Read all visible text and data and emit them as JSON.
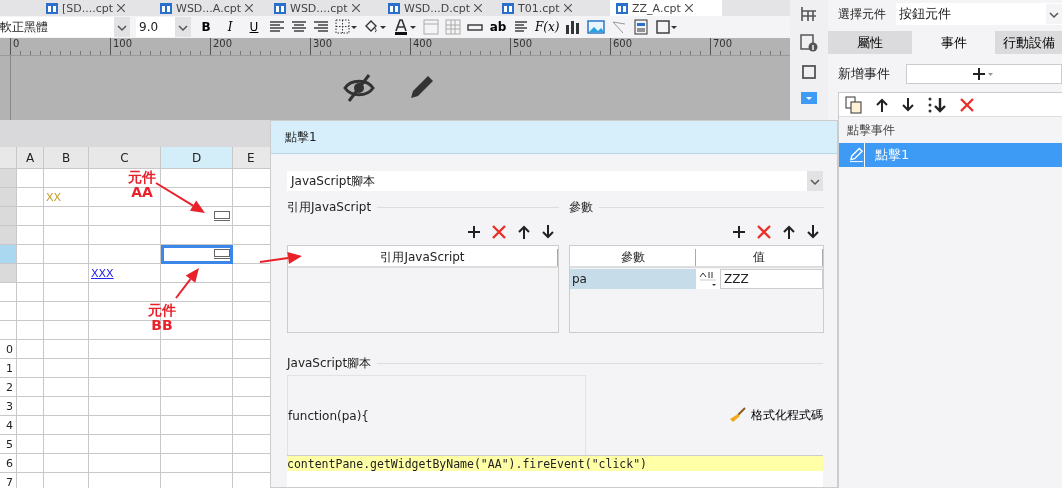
{
  "file_tabs": [
    {
      "label": "[SD....cpt",
      "selected": false
    },
    {
      "label": "WSD...A.cpt",
      "selected": false
    },
    {
      "label": "WSD....cpt",
      "selected": false
    },
    {
      "label": "WSD...D.cpt",
      "selected": false
    },
    {
      "label": "T01.cpt",
      "selected": false
    },
    {
      "label": "ZZ_A.cpt",
      "selected": true
    }
  ],
  "toolbar": {
    "font": "軟正黑體",
    "font_size": "9.0",
    "style_buttons": [
      "B",
      "I",
      "U"
    ],
    "text_widget": "ab",
    "formula": "F(x)"
  },
  "ruler": {
    "ticks": [
      "0",
      "100",
      "200",
      "300",
      "400",
      "500",
      "600",
      "700"
    ]
  },
  "sheet": {
    "columns": [
      {
        "label": "A",
        "selected": false
      },
      {
        "label": "B",
        "selected": false
      },
      {
        "label": "C",
        "selected": false
      },
      {
        "label": "D",
        "selected": true
      },
      {
        "label": "E",
        "selected": false
      }
    ],
    "rows": [
      {
        "selected": false,
        "shaded": true,
        "cells": []
      },
      {
        "selected": false,
        "shaded": true,
        "cells": [
          {
            "kind": "blank"
          },
          {
            "kind": "text",
            "text": "XX",
            "selected": false
          }
        ]
      },
      {
        "selected": false,
        "shaded": true,
        "cells": [
          {
            "kind": "blank"
          },
          {
            "kind": "blank"
          },
          {
            "kind": "blank"
          },
          {
            "kind": "widget",
            "selected": false
          }
        ]
      },
      {
        "selected": false,
        "shaded": true,
        "cells": []
      },
      {
        "selected": true,
        "shaded": true,
        "cells": [
          {
            "kind": "blank"
          },
          {
            "kind": "blank"
          },
          {
            "kind": "blank"
          },
          {
            "kind": "widget",
            "selected": true
          }
        ]
      },
      {
        "selected": false,
        "shaded": true,
        "cells": [
          {
            "kind": "blank"
          },
          {
            "kind": "blank"
          },
          {
            "kind": "link",
            "text": "XXX",
            "selected": false
          }
        ]
      },
      {
        "selected": false,
        "shaded": false,
        "cells": []
      },
      {
        "selected": false,
        "shaded": false,
        "cells": []
      },
      {
        "selected": false,
        "shaded": false,
        "cells": []
      },
      {
        "number": "0",
        "selected": false,
        "shaded": false,
        "cells": []
      },
      {
        "number": "1",
        "selected": false,
        "shaded": false,
        "cells": []
      },
      {
        "number": "2",
        "selected": false,
        "shaded": false,
        "cells": []
      },
      {
        "number": "3",
        "selected": false,
        "shaded": false,
        "cells": []
      },
      {
        "number": "4",
        "selected": false,
        "shaded": false,
        "cells": []
      },
      {
        "number": "5",
        "selected": false,
        "shaded": false,
        "cells": []
      },
      {
        "number": "6",
        "selected": false,
        "shaded": false,
        "cells": []
      },
      {
        "number": "7",
        "selected": false,
        "shaded": false,
        "cells": []
      }
    ]
  },
  "annotations": [
    {
      "lines": [
        "元件",
        "AA"
      ]
    },
    {
      "lines": [
        "元件",
        "BB"
      ]
    }
  ],
  "dialog": {
    "title": "點擊1",
    "type_select": "JavaScript腳本",
    "imports": {
      "label": "引用JavaScript",
      "column": "引用JavaScript"
    },
    "params": {
      "label": "參數",
      "columns": [
        "參數",
        "值"
      ],
      "rows": [
        {
          "name": "pa",
          "value": "ZZZ",
          "selected": true
        }
      ]
    },
    "script": {
      "label": "JavaScript腳本",
      "signature": "function(pa){",
      "format_button": "格式化程式碼",
      "code": "contentPane.getWidgetByName(\"AA\").fireEvent(\"click\")"
    }
  },
  "right_panel": {
    "component_label": "選擇元件",
    "component_value": "按鈕元件",
    "tabs": [
      {
        "label": "屬性",
        "selected": false
      },
      {
        "label": "事件",
        "selected": true
      },
      {
        "label": "行動設備",
        "selected": false
      }
    ],
    "add_event_label": "新增事件",
    "event_group": "點擊事件",
    "events": [
      {
        "label": "點擊1",
        "selected": true
      }
    ]
  }
}
